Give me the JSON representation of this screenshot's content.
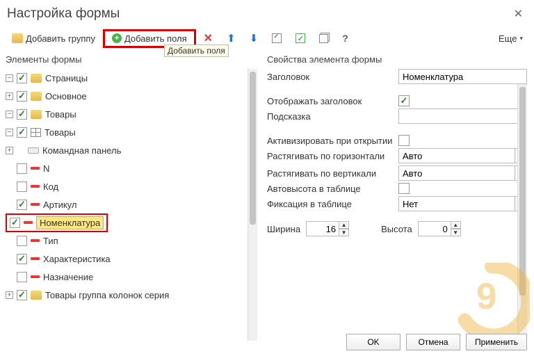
{
  "title": "Настройка формы",
  "toolbar": {
    "add_group": "Добавить группу",
    "add_fields": "Добавить поля",
    "hint": "Добавить поля",
    "more": "Еще"
  },
  "left_title": "Элементы формы",
  "right_title": "Свойства элемента формы",
  "tree": {
    "pages": "Страницы",
    "main": "Основное",
    "goods": "Товары",
    "goods_table": "Товары",
    "cmd_panel": "Командная панель",
    "n": "N",
    "code": "Код",
    "article": "Артикул",
    "nomen": "Номенклатура",
    "type": "Тип",
    "char": "Характеристика",
    "purpose": "Назначение",
    "col_group": "Товары группа колонок серия"
  },
  "props": {
    "label_title": "Заголовок",
    "title_value": "Номенклатура",
    "label_show_title": "Отображать заголовок",
    "label_hint": "Подсказка",
    "hint_value": "",
    "label_activate": "Активизировать при открытии",
    "label_stretch_h": "Растягивать по горизонтали",
    "stretch_h_value": "Авто",
    "label_stretch_v": "Растягивать по вертикали",
    "stretch_v_value": "Авто",
    "label_autoh": "Автовысота в таблице",
    "label_fixation": "Фиксация в таблице",
    "fixation_value": "Нет",
    "label_width": "Ширина",
    "width_value": "16",
    "label_height": "Высота",
    "height_value": "0"
  },
  "buttons": {
    "ok": "OK",
    "cancel": "Отмена",
    "apply": "Применить"
  }
}
